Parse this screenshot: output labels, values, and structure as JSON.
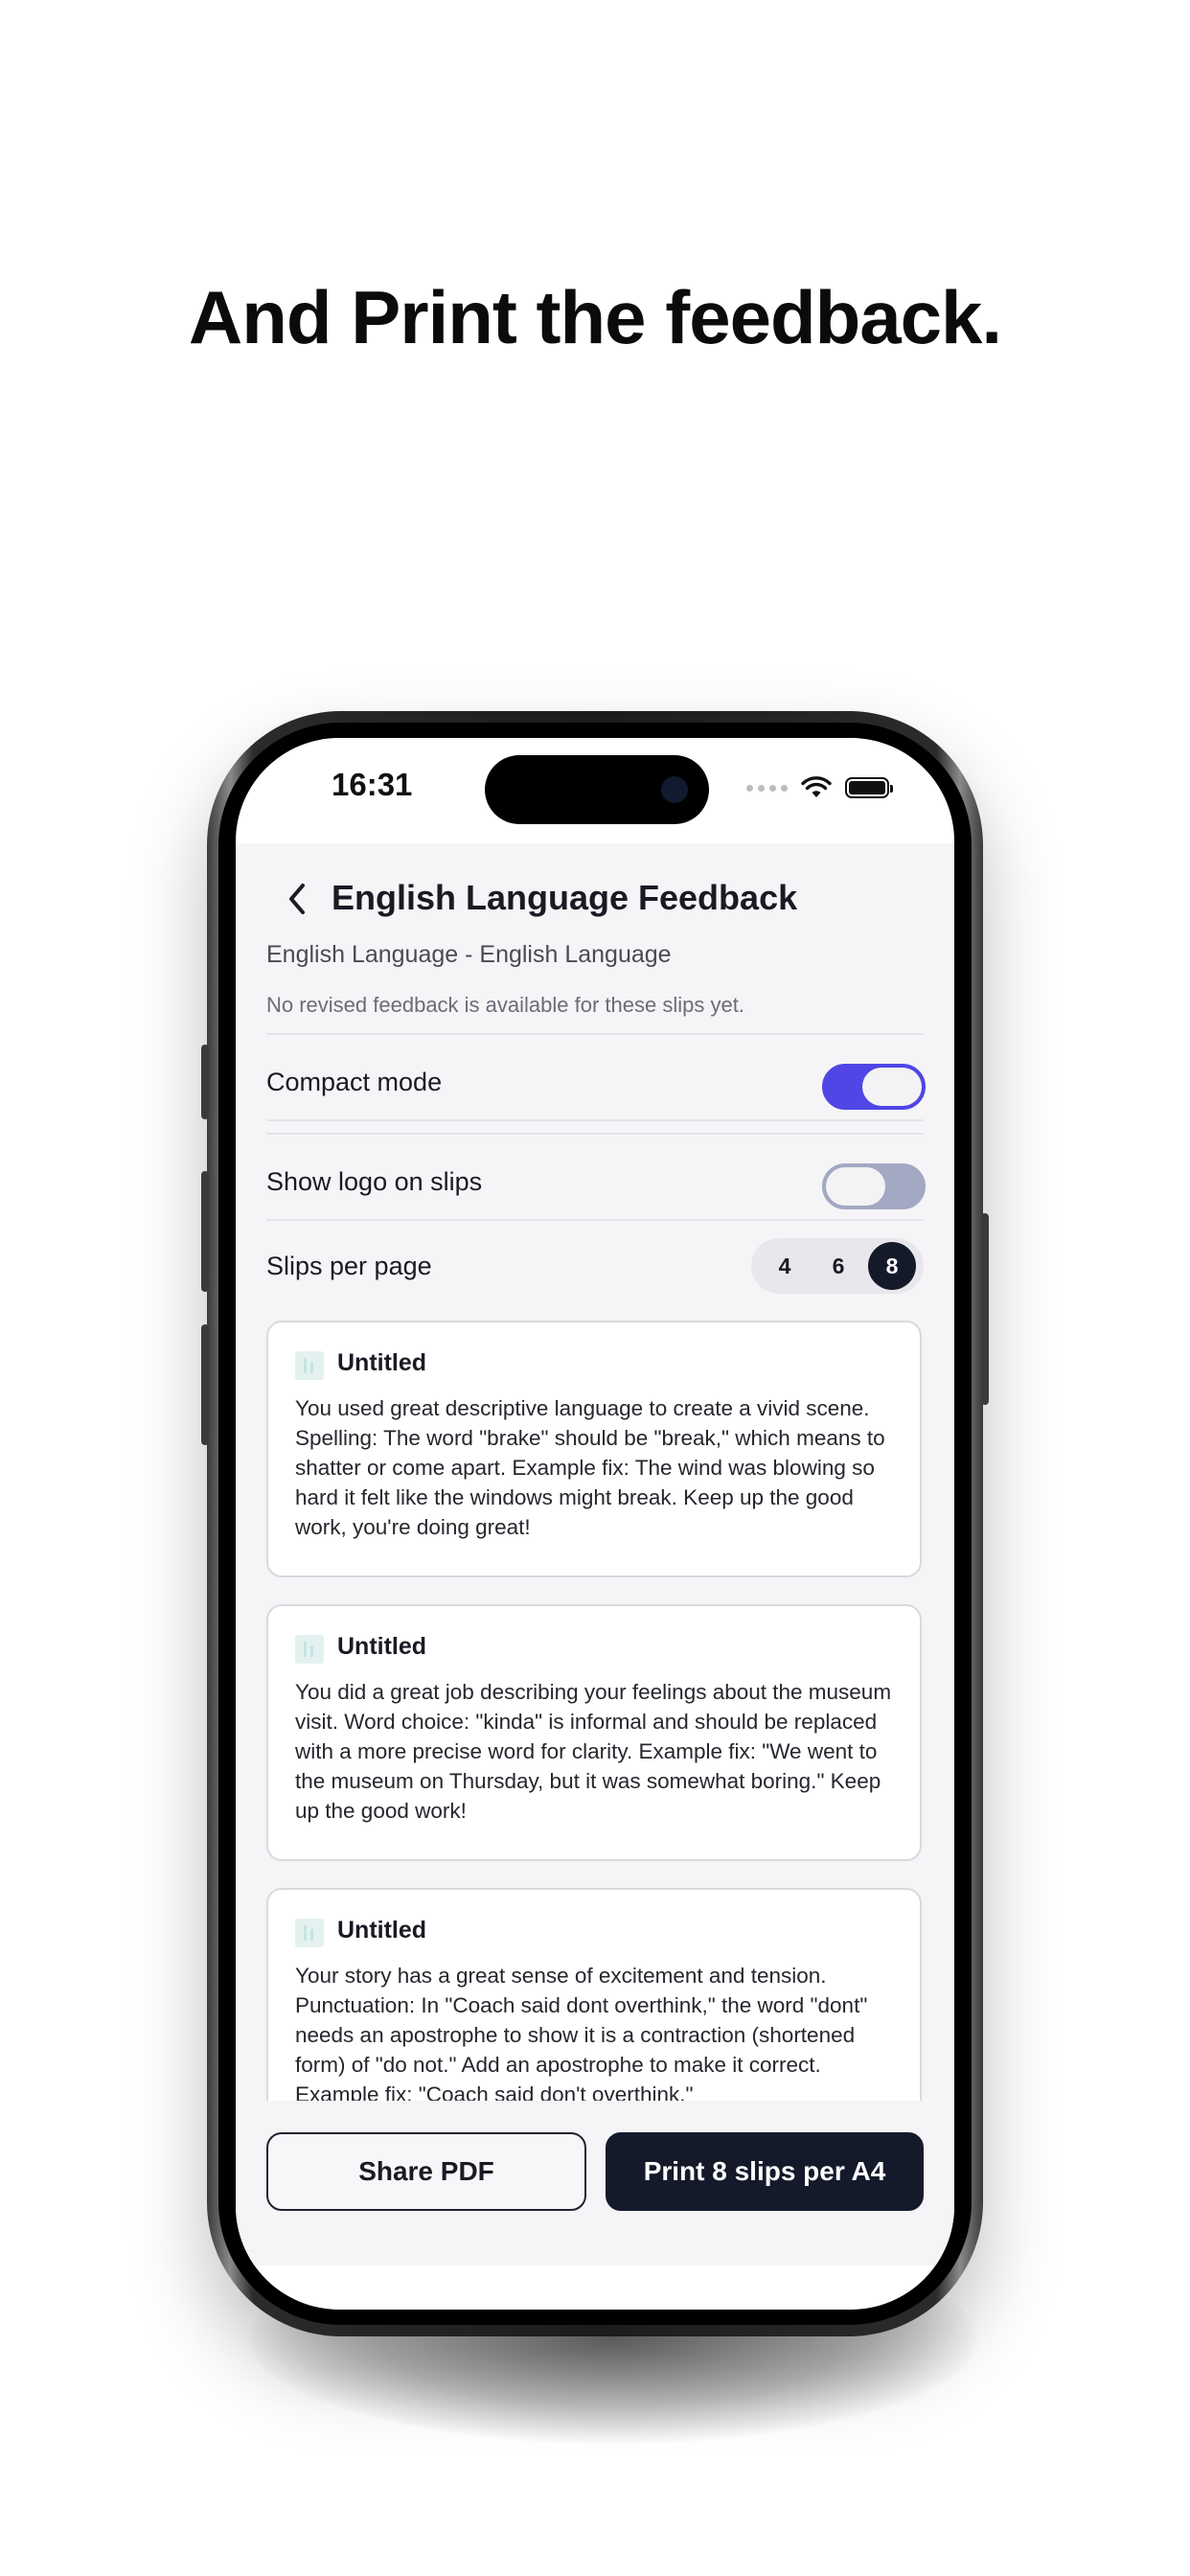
{
  "headline": "And Print the feedback.",
  "status_bar": {
    "time": "16:31"
  },
  "header": {
    "title": "English Language Feedback",
    "subject": "English Language - English Language",
    "notice": "No revised feedback is available for these slips yet."
  },
  "settings": {
    "compact_mode": {
      "label": "Compact mode",
      "enabled": true
    },
    "show_logo": {
      "label": "Show logo on slips",
      "enabled": false
    },
    "slips_per_page": {
      "label": "Slips per page",
      "options": [
        "4",
        "6",
        "8"
      ],
      "selected": "8"
    }
  },
  "slips": [
    {
      "title": "Untitled",
      "body": "You used great descriptive language to create a vivid scene. Spelling: The word \"brake\" should be \"break,\" which means to shatter or come apart. Example fix:  The wind was blowing so hard it felt like the windows might break. Keep up the good work, you're doing great!"
    },
    {
      "title": "Untitled",
      "body": "You did a great job describing your feelings about the museum visit. Word choice: \"kinda\" is informal and should be replaced with a more precise word for clarity. Example fix:  \"We went to the museum on Thursday, but it was somewhat boring.\" Keep up the good work!"
    },
    {
      "title": "Untitled",
      "body": "Your story has a great sense of excitement and tension.\nPunctuation: In \"Coach said dont overthink,\" the word \"dont\" needs an apostrophe to show it is a contraction (shortened form) of \"do not.\" Add an apostrophe to make it correct. Example fix:  \"Coach said don't overthink.\""
    }
  ],
  "actions": {
    "share_label": "Share PDF",
    "print_label": "Print 8 slips per A4"
  },
  "colors": {
    "accent": "#4f46e5",
    "dark": "#151a2b",
    "background": "#f5f5f7"
  }
}
